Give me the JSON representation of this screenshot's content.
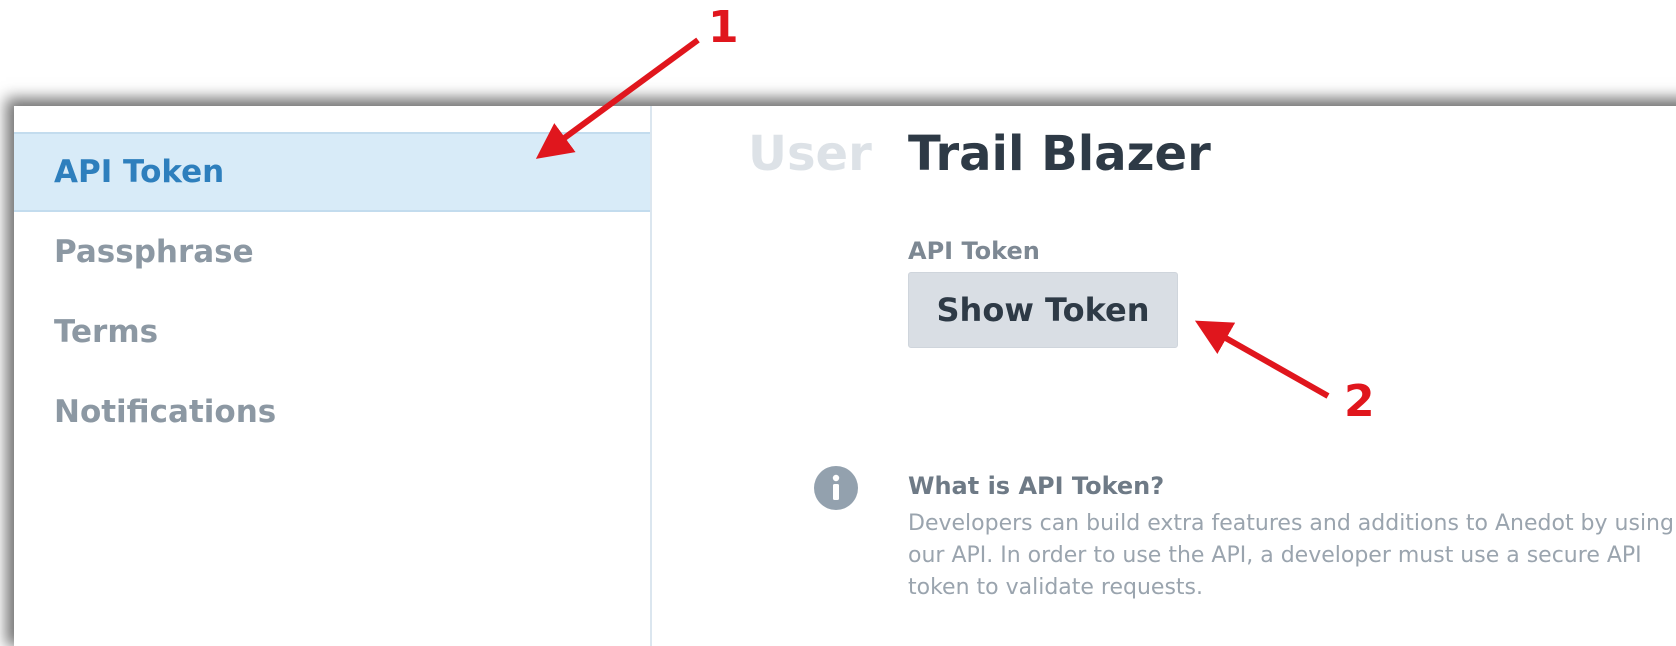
{
  "sidebar": {
    "items": [
      {
        "label": "API Token",
        "active": true
      },
      {
        "label": "Passphrase",
        "active": false
      },
      {
        "label": "Terms",
        "active": false
      },
      {
        "label": "Notifications",
        "active": false
      }
    ]
  },
  "header": {
    "label": "User",
    "name": "Trail Blazer"
  },
  "api_token": {
    "field_label": "API Token",
    "button_label": "Show Token"
  },
  "info": {
    "icon": "info-icon",
    "title": "What is API Token?",
    "text": "Developers can build extra features and additions to Anedot by using our API. In order to use the API, a developer must use a secure API token to validate requests."
  },
  "annotations": {
    "marker_1": "1",
    "marker_2": "2",
    "color": "#e0161d"
  },
  "colors": {
    "accent": "#2e7fbd",
    "active_bg": "#d8ebf8",
    "button_bg": "#d9dee4"
  }
}
